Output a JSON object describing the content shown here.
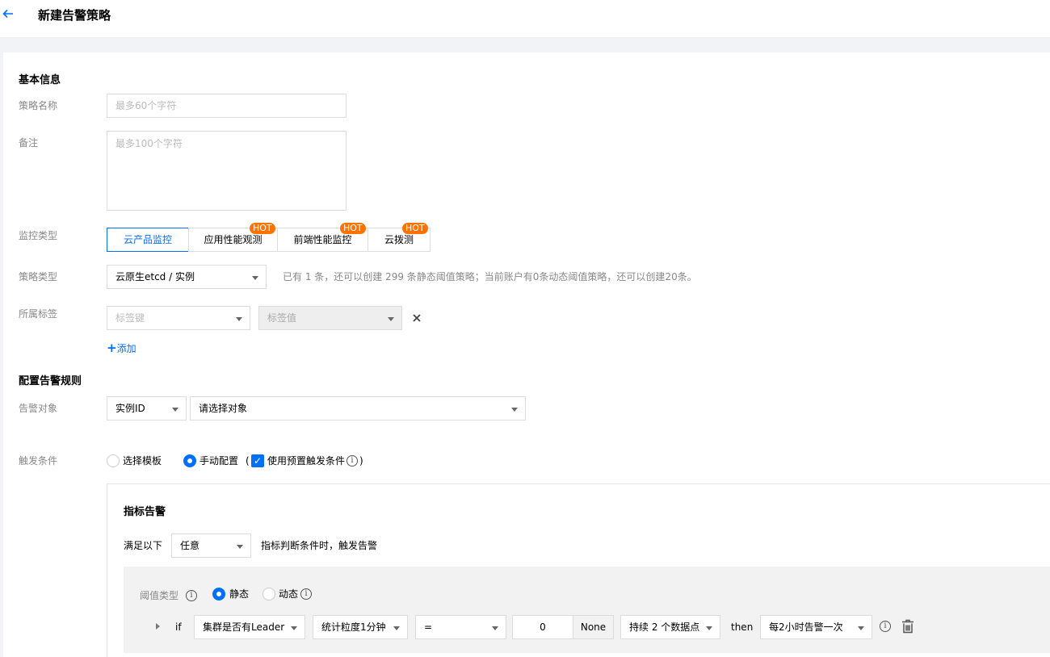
{
  "header": {
    "title": "新建告警策略",
    "back_icon": "arrow-left-icon"
  },
  "basic": {
    "section_title": "基本信息",
    "name_label": "策略名称",
    "name_placeholder": "最多60个字符",
    "remark_label": "备注",
    "remark_placeholder": "最多100个字符",
    "monitor_type_label": "监控类型",
    "monitor_tabs": [
      {
        "label": "云产品监控",
        "active": true,
        "hot": false
      },
      {
        "label": "应用性能观测",
        "active": false,
        "hot": true
      },
      {
        "label": "前端性能监控",
        "active": false,
        "hot": true
      },
      {
        "label": "云拨测",
        "active": false,
        "hot": true
      }
    ],
    "hot_badge": "HOT",
    "policy_type_label": "策略类型",
    "policy_type_value": "云原生etcd / 实例",
    "policy_type_hint": "已有 1 条，还可以创建 299 条静态阈值策略；当前账户有0条动态阈值策略，还可以创建20条。",
    "tags_label": "所属标签",
    "tag_key_placeholder": "标签键",
    "tag_value_placeholder": "标签值",
    "add_link": "添加"
  },
  "rules": {
    "section_title": "配置告警规则",
    "target_label": "告警对象",
    "target_type": "实例ID",
    "target_placeholder": "请选择对象",
    "trigger_label": "触发条件",
    "trigger_options": [
      "选择模板",
      "手动配置"
    ],
    "trigger_selected": "手动配置",
    "preset_paren_open": "(",
    "preset_label": "使用预置触发条件",
    "preset_paren_close": ")",
    "preset_checked": true
  },
  "metric": {
    "title": "指标告警",
    "satisfy_prefix": "满足以下",
    "satisfy_value": "任意",
    "satisfy_suffix": "指标判断条件时，触发告警",
    "threshold_label": "阈值类型",
    "threshold_options": [
      "静态",
      "动态"
    ],
    "threshold_selected": "静态",
    "condition": {
      "if_label": "if",
      "metric": "集群是否有Leader",
      "granularity": "统计粒度1分钟",
      "operator": "=",
      "value": "0",
      "unit": "None",
      "duration": "持续 2 个数据点",
      "then_label": "then",
      "frequency": "每2小时告警一次"
    }
  }
}
